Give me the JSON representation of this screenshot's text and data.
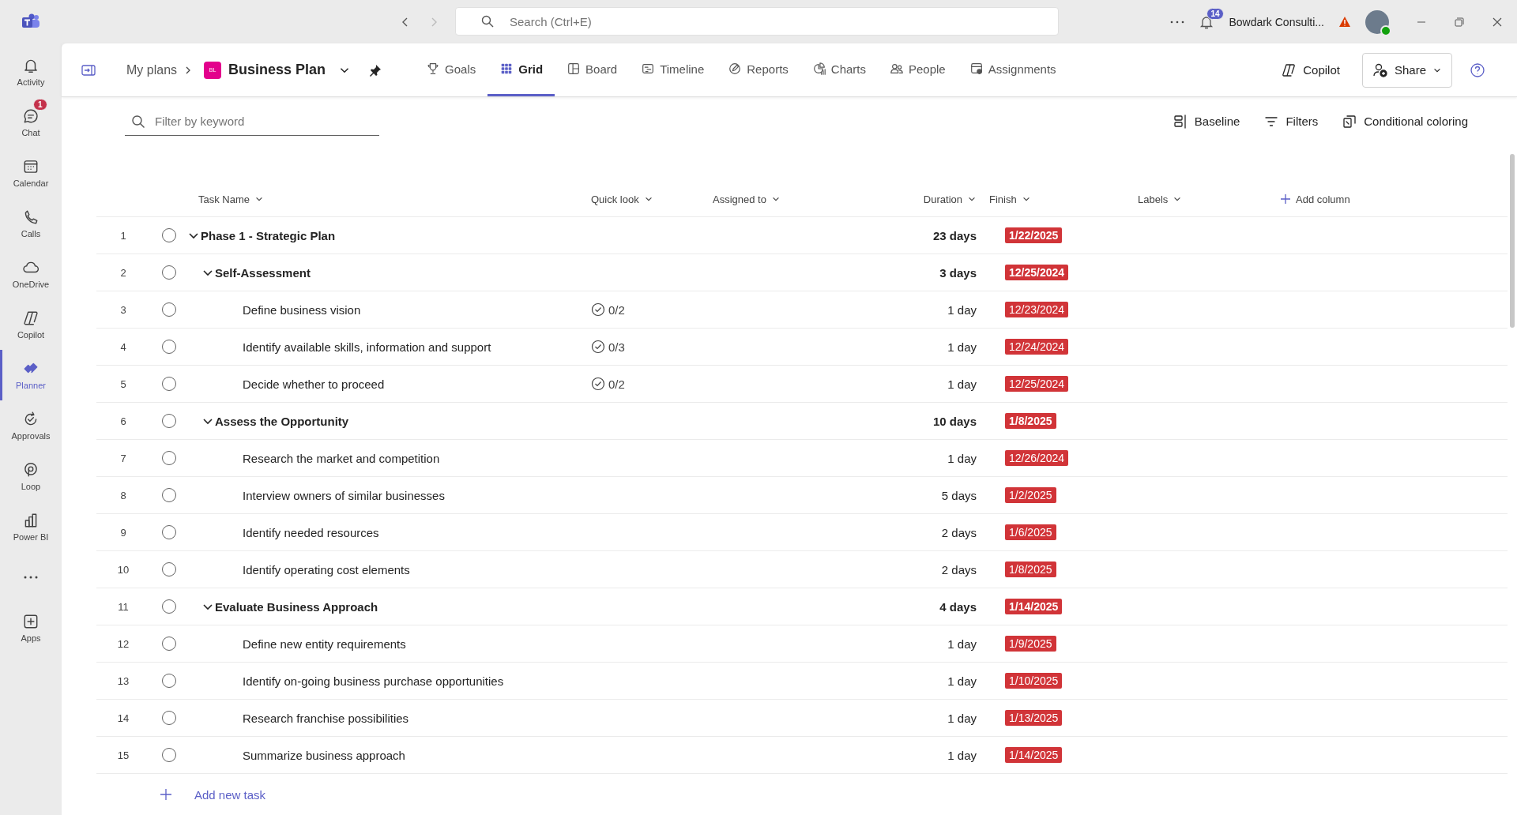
{
  "title_bar": {
    "search": {
      "placeholder": "Search (Ctrl+E)"
    },
    "notifications": "14",
    "account": "Bowdark Consulti..."
  },
  "rail": [
    {
      "label": "Activity",
      "selected": false
    },
    {
      "label": "Chat",
      "badge": "1",
      "selected": false
    },
    {
      "label": "Calendar",
      "selected": false
    },
    {
      "label": "Calls",
      "selected": false
    },
    {
      "label": "OneDrive",
      "selected": false
    },
    {
      "label": "Copilot",
      "selected": false
    },
    {
      "label": "Planner",
      "selected": true
    },
    {
      "label": "Approvals",
      "selected": false
    },
    {
      "label": "Loop",
      "selected": false
    },
    {
      "label": "Power BI",
      "selected": false
    },
    {
      "selected": false
    },
    {
      "label": "Apps",
      "selected": false
    }
  ],
  "header": {
    "breadcrumb": "My plans",
    "plan_icon": "BL",
    "plan": "Business Plan",
    "tabs": [
      {
        "label": "Goals",
        "selected": false
      },
      {
        "label": "Grid",
        "selected": true
      },
      {
        "label": "Board",
        "selected": false
      },
      {
        "label": "Timeline",
        "selected": false
      },
      {
        "label": "Reports",
        "selected": false
      },
      {
        "label": "Charts",
        "selected": false
      },
      {
        "label": "People",
        "selected": false
      },
      {
        "label": "Assignments",
        "selected": false
      }
    ],
    "copilot": "Copilot",
    "share": "Share"
  },
  "toolbar": {
    "filter": {
      "placeholder": "Filter by keyword"
    },
    "buttons": [
      "Baseline",
      "Filters",
      "Conditional coloring"
    ]
  },
  "table": {
    "columns": [
      "Task Name",
      "Quick look",
      "Assigned to",
      "Duration",
      "Finish",
      "Labels"
    ],
    "add_column": "Add column",
    "rows": [
      {
        "number": "1",
        "name": "Phase 1 - Strategic Plan",
        "kind": "group",
        "expanded": true,
        "completed": false,
        "duration": "23 days",
        "finish": "1/22/2025",
        "children": [
          {
            "number": "2",
            "name": "Self-Assessment",
            "kind": "group",
            "expanded": true,
            "completed": false,
            "duration": "3 days",
            "finish": "12/25/2024",
            "children": [
              {
                "number": "3",
                "name": "Define business vision",
                "kind": "task",
                "completed": false,
                "quick_look": "0/2",
                "duration": "1 day",
                "finish": "12/23/2024"
              },
              {
                "number": "4",
                "name": "Identify available skills, information and support",
                "kind": "task",
                "completed": false,
                "quick_look": "0/3",
                "duration": "1 day",
                "finish": "12/24/2024"
              },
              {
                "number": "5",
                "name": "Decide whether to proceed",
                "kind": "task",
                "completed": false,
                "quick_look": "0/2",
                "duration": "1 day",
                "finish": "12/25/2024"
              }
            ]
          },
          {
            "number": "6",
            "name": "Assess the Opportunity",
            "kind": "group",
            "expanded": true,
            "completed": false,
            "duration": "10 days",
            "finish": "1/8/2025",
            "children": [
              {
                "number": "7",
                "name": "Research the market and competition",
                "kind": "task",
                "completed": false,
                "duration": "1 day",
                "finish": "12/26/2024"
              },
              {
                "number": "8",
                "name": "Interview owners of similar businesses",
                "kind": "task",
                "completed": false,
                "duration": "5 days",
                "finish": "1/2/2025"
              },
              {
                "number": "9",
                "name": "Identify needed resources",
                "kind": "task",
                "completed": false,
                "duration": "2 days",
                "finish": "1/6/2025"
              },
              {
                "number": "10",
                "name": "Identify operating cost elements",
                "kind": "task",
                "completed": false,
                "duration": "2 days",
                "finish": "1/8/2025"
              }
            ]
          },
          {
            "number": "11",
            "name": "Evaluate Business Approach",
            "kind": "group",
            "expanded": true,
            "completed": false,
            "duration": "4 days",
            "finish": "1/14/2025",
            "children": [
              {
                "number": "12",
                "name": "Define new entity requirements",
                "kind": "task",
                "completed": false,
                "duration": "1 day",
                "finish": "1/9/2025"
              },
              {
                "number": "13",
                "name": "Identify on-going business purchase opportunities",
                "kind": "task",
                "completed": false,
                "duration": "1 day",
                "finish": "1/10/2025"
              },
              {
                "number": "14",
                "name": "Research franchise possibilities",
                "kind": "task",
                "completed": false,
                "duration": "1 day",
                "finish": "1/13/2025"
              },
              {
                "number": "15",
                "name": "Summarize business approach",
                "kind": "task",
                "completed": false,
                "duration": "1 day",
                "finish": "1/14/2025"
              }
            ]
          }
        ]
      }
    ],
    "add_task": "Add new task"
  }
}
